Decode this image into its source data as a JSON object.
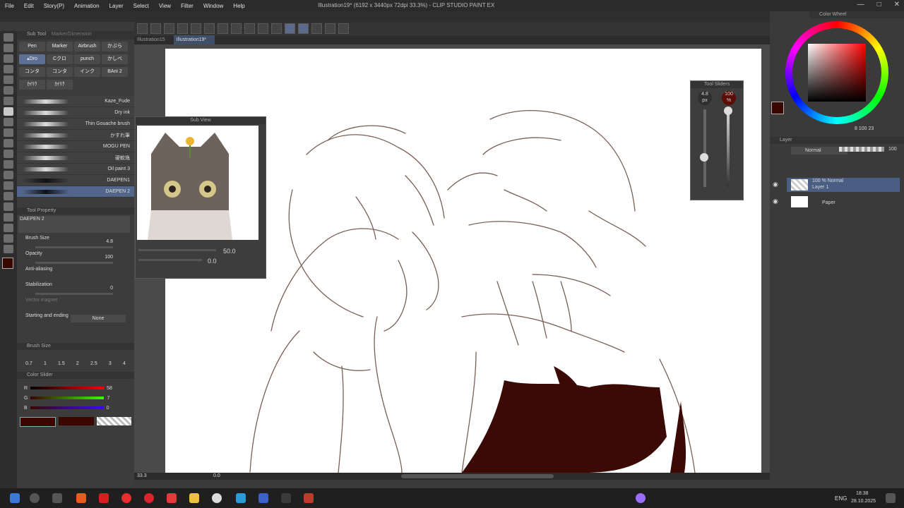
{
  "menu": [
    "File",
    "Edit",
    "Story(P)",
    "Animation",
    "Layer",
    "Select",
    "View",
    "Filter",
    "Window",
    "Help"
  ],
  "window_title": "Illustration19* (6192 x 3440px 72dpi 33.3%) - CLIP STUDIO PAINT EX",
  "tabs": [
    {
      "label": "Illustration15"
    },
    {
      "label": "Illustration19*"
    }
  ],
  "subtool_panel": {
    "header_sub_tool": "Sub Tool",
    "header_marker": "Marker/Dimension",
    "tool_buttons": [
      "Pen",
      "Marker",
      "Airbrush",
      "かぶら",
      "▴Dro",
      "Cクロ",
      "punch",
      "かしべ",
      "コンタ",
      "コンタ",
      "インク",
      "BAni 2",
      "ｶｲﾘｸ",
      "ｶｲﾘｸ"
    ],
    "brushes": [
      "Kaze_Fude",
      "Dry ink",
      "Thin Gouache brush",
      "かすれ筆",
      "MOGU PEN",
      "硬軟逸",
      "Oil paint 3",
      "DAEPEN1",
      "DAEPEN 2"
    ]
  },
  "tool_property": {
    "header": "Tool Property",
    "preset_name": "DAEPEN 2",
    "brush_size_label": "Brush Size",
    "brush_size_value": "4.8",
    "opacity_label": "Opacity",
    "opacity_value": "100",
    "antialiasing_label": "Anti-aliasing",
    "stabilization_label": "Stabilization",
    "stabilization_value": "0",
    "vector_magnet_label": "Vector magnet",
    "starting_ending_label": "Starting and ending",
    "starting_ending_value": "None"
  },
  "brush_size_panel": {
    "header": "Brush Size",
    "sizes": [
      "0.7",
      "1",
      "1.5",
      "2",
      "2.5",
      "3",
      "4"
    ]
  },
  "color_slider": {
    "header": "Color Slider",
    "r_label": "R",
    "r_value": "58",
    "g_label": "G",
    "g_value": "7",
    "b_label": "B",
    "b_value": "0",
    "main_color": "#3a0700"
  },
  "sub_view": {
    "header": "Sub View",
    "zoom": "50.0",
    "rotation": "0.0"
  },
  "tool_sliders": {
    "header": "Tool Sliders",
    "size_value": "4.8",
    "size_unit": "px",
    "opacity_value": "100",
    "opacity_unit": "%"
  },
  "color_wheel": {
    "header": "Color Wheel",
    "readout": "8  100  23"
  },
  "layer_panel": {
    "header": "Layer",
    "blend_mode": "Normal",
    "opacity": "100",
    "layers": [
      {
        "line1": "100 % Normal",
        "line2": "Layer 1"
      },
      {
        "line1": "",
        "line2": "Paper"
      }
    ]
  },
  "status": {
    "zoom": "33.3",
    "angle": "0.0"
  },
  "taskbar": {
    "lang": "ENG",
    "time": "18:38",
    "date": "28.10.2025"
  },
  "colors": {
    "accent": "#5b6f94",
    "ink": "#3b0a05",
    "sketch": "#7a5f56"
  }
}
